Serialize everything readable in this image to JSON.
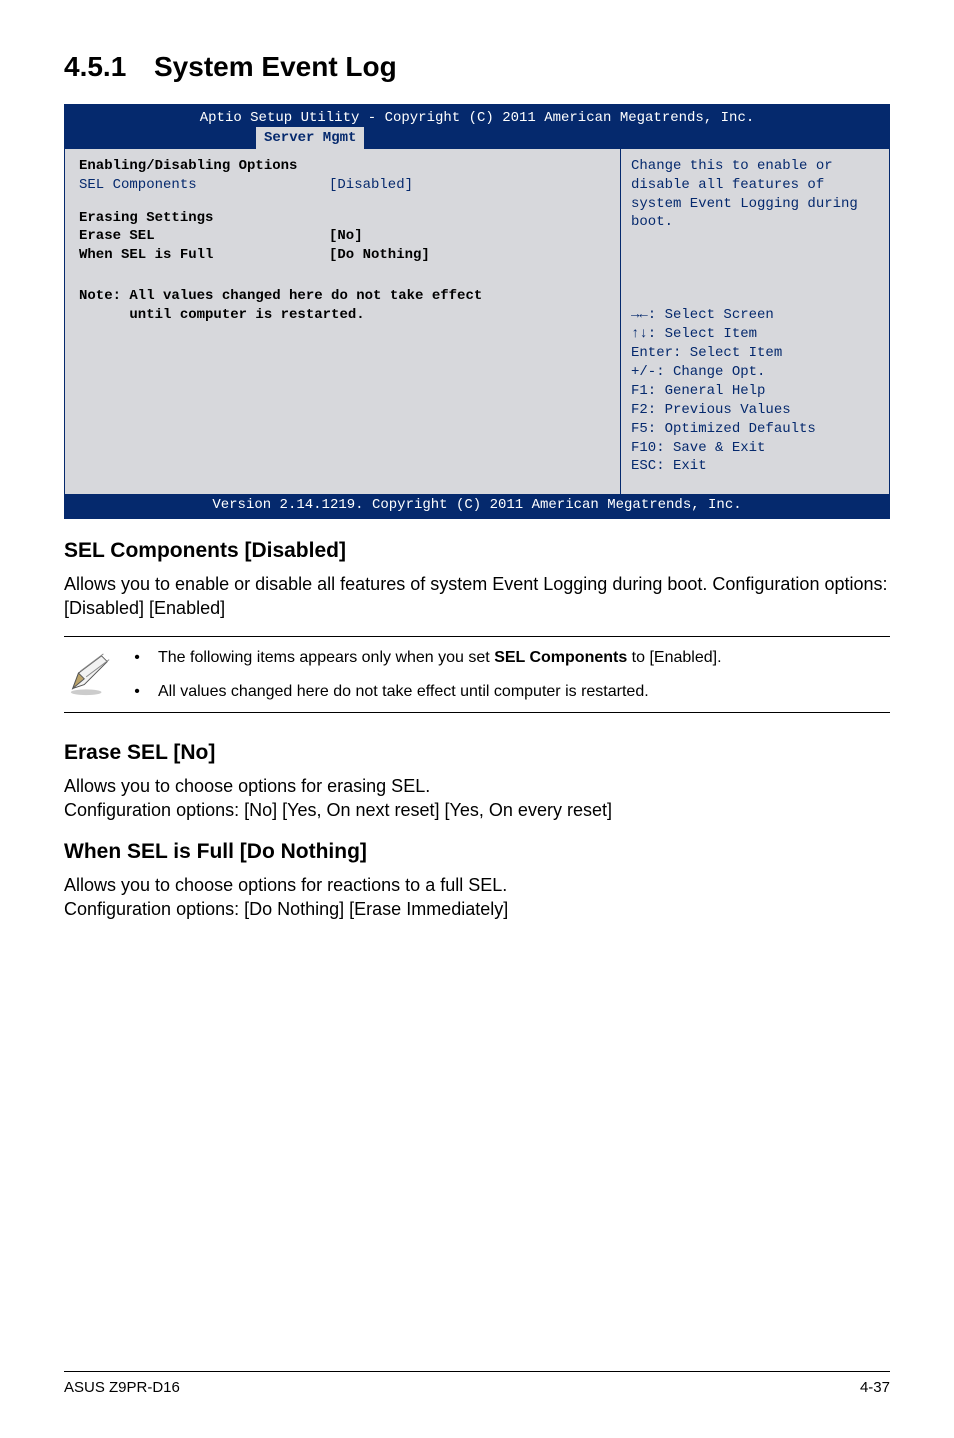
{
  "section": {
    "number": "4.5.1",
    "title": "System Event Log"
  },
  "bios": {
    "header": "Aptio Setup Utility - Copyright (C) 2011 American Megatrends, Inc.",
    "tab": "Server Mgmt",
    "group1_heading": "Enabling/Disabling Options",
    "sel_components_label": "SEL Components",
    "sel_components_value": "[Disabled]",
    "group2_heading": "Erasing Settings",
    "erase_sel_label": "Erase SEL",
    "erase_sel_value": "[No]",
    "when_full_label": "When SEL is Full",
    "when_full_value": "[Do Nothing]",
    "note_line1": "Note: All values changed here do not take effect",
    "note_line2": "      until computer is restarted.",
    "help_text": "Change this to enable or disable all features of system Event Logging during boot.",
    "nav": {
      "l1": "→←: Select Screen",
      "l2": "↑↓:  Select Item",
      "l3": "Enter: Select Item",
      "l4": "+/-: Change Opt.",
      "l5": "F1: General Help",
      "l6": "F2: Previous Values",
      "l7": "F5: Optimized Defaults",
      "l8": "F10: Save & Exit",
      "l9": "ESC: Exit"
    },
    "footer": "Version 2.14.1219. Copyright (C) 2011 American Megatrends, Inc."
  },
  "sub1": {
    "heading": "SEL Components [Disabled]",
    "body": "Allows you to enable or disable all features of system Event Logging during boot. Configuration options: [Disabled] [Enabled]"
  },
  "note": {
    "item1a": "The following items appears only when you set ",
    "item1b": "SEL Components",
    "item1c": " to [Enabled].",
    "item2": "All values changed here do not take effect until computer is restarted."
  },
  "sub2": {
    "heading": "Erase SEL [No]",
    "body": "Allows you to choose options for erasing SEL.\nConfiguration options: [No] [Yes, On next reset] [Yes, On every reset]"
  },
  "sub3": {
    "heading": "When SEL is Full [Do Nothing]",
    "body": "Allows you to choose options for reactions to a full SEL.\nConfiguration options: [Do Nothing] [Erase Immediately]"
  },
  "footer": {
    "left": "ASUS Z9PR-D16",
    "right": "4-37"
  }
}
